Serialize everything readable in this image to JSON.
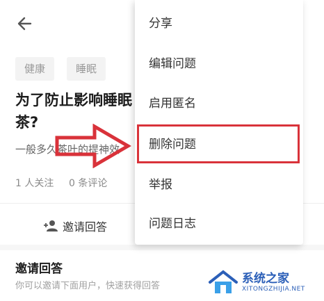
{
  "header": {
    "back_icon": "arrow-left-icon"
  },
  "tags": [
    "健康",
    "睡眠"
  ],
  "question": {
    "title": "为了防止影响睡眠\n茶?",
    "excerpt": "一般多久茶叶的提神效",
    "followers": "1 人关注",
    "comments": "0 条评论"
  },
  "invite_button": {
    "label": "邀请回答",
    "icon": "add-person-icon"
  },
  "invite_section": {
    "title": "邀请回答",
    "subtitle": "你可以邀请下面用户，快速获得回答"
  },
  "menu": {
    "items": [
      {
        "label": "分享"
      },
      {
        "label": "编辑问题"
      },
      {
        "label": "启用匿名"
      },
      {
        "label": "删除问题"
      },
      {
        "label": "举报"
      },
      {
        "label": "问题日志"
      }
    ],
    "highlighted_index": 3
  },
  "annotation": {
    "arrow_color": "#d9323a",
    "box_color": "#d9323a"
  },
  "watermark": {
    "main": "系统之家",
    "sub": "XITONGZHIJIA.NET",
    "color": "#2b5fb8"
  }
}
